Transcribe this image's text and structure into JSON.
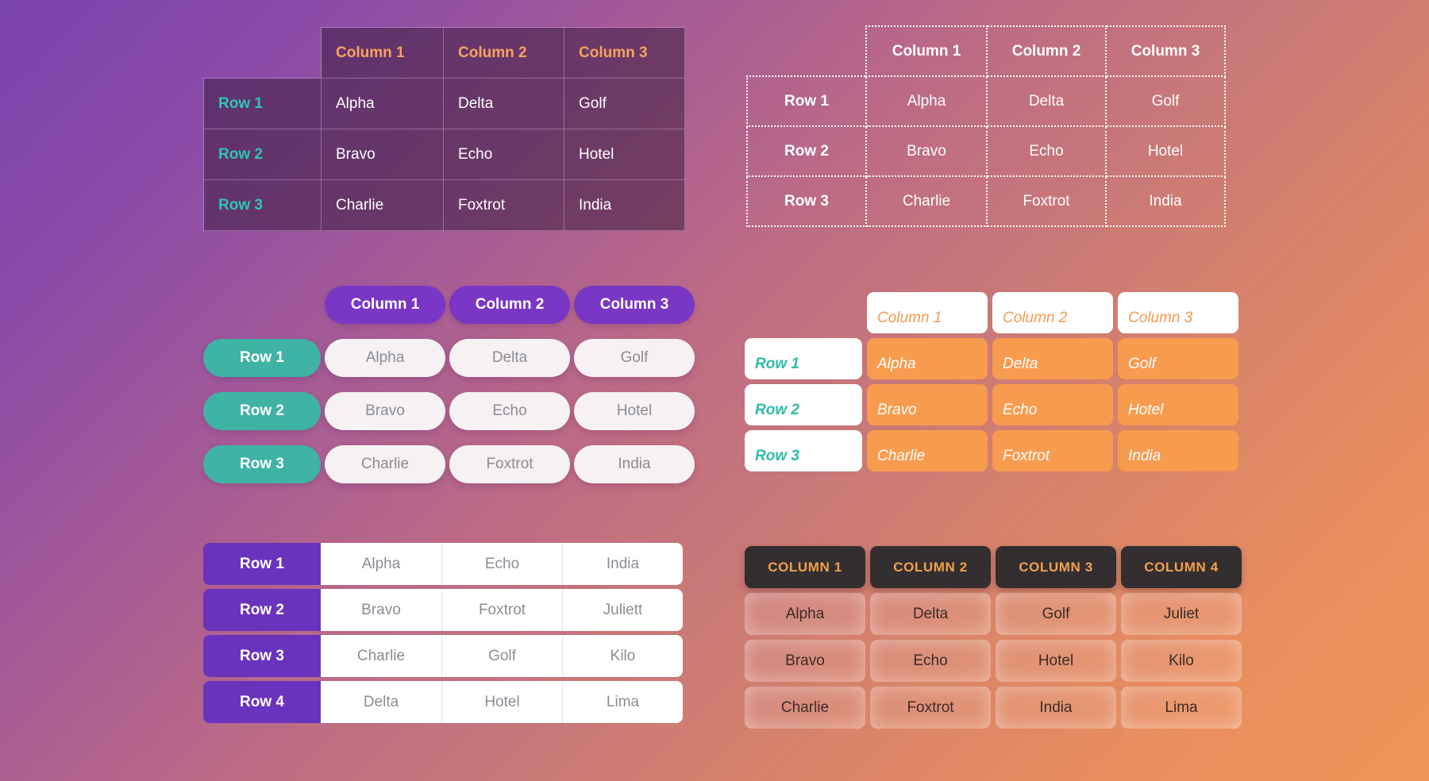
{
  "tables": {
    "classic_dark": {
      "columns": [
        "Column 1",
        "Column 2",
        "Column 3"
      ],
      "rows": [
        {
          "label": "Row 1",
          "cells": [
            "Alpha",
            "Delta",
            "Golf"
          ]
        },
        {
          "label": "Row 2",
          "cells": [
            "Bravo",
            "Echo",
            "Hotel"
          ]
        },
        {
          "label": "Row 3",
          "cells": [
            "Charlie",
            "Foxtrot",
            "India"
          ]
        }
      ],
      "colors": {
        "cell_background": "#381a3c",
        "header_text": "#f9a25c",
        "row_label_text": "#2dc7b1",
        "data_text": "#ffffff",
        "border": "#e6beeb"
      }
    },
    "dotted": {
      "columns": [
        "Column 1",
        "Column 2",
        "Column 3"
      ],
      "rows": [
        {
          "label": "Row 1",
          "cells": [
            "Alpha",
            "Delta",
            "Golf"
          ]
        },
        {
          "label": "Row 2",
          "cells": [
            "Bravo",
            "Echo",
            "Hotel"
          ]
        },
        {
          "label": "Row 3",
          "cells": [
            "Charlie",
            "Foxtrot",
            "India"
          ]
        }
      ],
      "colors": {
        "border": "#ffffff",
        "text": "#ffffff"
      }
    },
    "pills": {
      "columns": [
        "Column 1",
        "Column 2",
        "Column 3"
      ],
      "rows": [
        {
          "label": "Row 1",
          "cells": [
            "Alpha",
            "Delta",
            "Golf"
          ]
        },
        {
          "label": "Row 2",
          "cells": [
            "Bravo",
            "Echo",
            "Hotel"
          ]
        },
        {
          "label": "Row 3",
          "cells": [
            "Charlie",
            "Foxtrot",
            "India"
          ]
        }
      ],
      "colors": {
        "header_background": "#7a36c4",
        "row_label_background": "#3fb3a4",
        "data_background": "#f6f1f3",
        "data_text": "#8c8c95",
        "header_text": "#ffffff"
      }
    },
    "orange_cards": {
      "columns": [
        "Column 1",
        "Column 2",
        "Column 3"
      ],
      "rows": [
        {
          "label": "Row 1",
          "cells": [
            "Alpha",
            "Delta",
            "Golf"
          ]
        },
        {
          "label": "Row 2",
          "cells": [
            "Bravo",
            "Echo",
            "Hotel"
          ]
        },
        {
          "label": "Row 3",
          "cells": [
            "Charlie",
            "Foxtrot",
            "India"
          ]
        }
      ],
      "colors": {
        "header_background": "#ffffff",
        "header_text": "#f59a53",
        "row_label_text": "#2dbda8",
        "data_background": "#f79b4e",
        "data_text": "#ffffff"
      }
    },
    "row_strips": {
      "rows": [
        {
          "label": "Row 1",
          "cells": [
            "Alpha",
            "Echo",
            "India"
          ]
        },
        {
          "label": "Row 2",
          "cells": [
            "Bravo",
            "Foxtrot",
            "Juliett"
          ]
        },
        {
          "label": "Row 3",
          "cells": [
            "Charlie",
            "Golf",
            "Kilo"
          ]
        },
        {
          "label": "Row 4",
          "cells": [
            "Delta",
            "Hotel",
            "Lima"
          ]
        }
      ],
      "colors": {
        "row_label_background": "#6a33bd",
        "row_label_text": "#ffffff",
        "data_background": "#ffffff",
        "data_text": "#8c8c95"
      }
    },
    "dark_headers": {
      "columns": [
        "COLUMN 1",
        "COLUMN 2",
        "COLUMN 3",
        "COLUMN 4"
      ],
      "rows": [
        [
          "Alpha",
          "Delta",
          "Golf",
          "Juliet"
        ],
        [
          "Bravo",
          "Echo",
          "Hotel",
          "Kilo"
        ],
        [
          "Charlie",
          "Foxtrot",
          "India",
          "Lima"
        ]
      ],
      "colors": {
        "header_background": "#332e30",
        "header_text": "#f4a04a",
        "data_text": "#3b2a28"
      }
    }
  },
  "background": {
    "gradient_start": "#7b43ad",
    "gradient_mid": "#c87878",
    "gradient_end": "#f09459"
  }
}
